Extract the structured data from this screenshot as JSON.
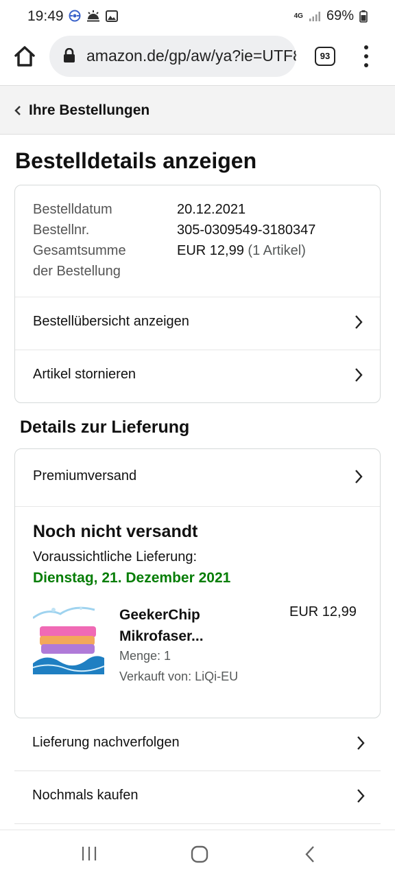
{
  "status_bar": {
    "time": "19:49",
    "network": "4G",
    "battery": "69%"
  },
  "browser": {
    "url": "amazon.de/gp/aw/ya?ie=UTF8",
    "tab_count": "93"
  },
  "back_link": {
    "label": "Ihre Bestellungen"
  },
  "page_title": "Bestelldetails anzeigen",
  "order_summary": {
    "date_label": "Bestelldatum",
    "date_value": "20.12.2021",
    "number_label": "Bestellnr.",
    "number_value": "305-0309549-3180347",
    "total_label_line1": "Gesamtsumme",
    "total_label_line2": "der Bestellung",
    "total_value": "EUR 12,99",
    "total_count": "(1 Artikel)",
    "rows": [
      {
        "label": "Bestellübersicht anzeigen"
      },
      {
        "label": "Artikel stornieren"
      }
    ]
  },
  "delivery": {
    "section_title": "Details zur Lieferung",
    "shipping_method": "Premiumversand",
    "status": "Noch nicht versandt",
    "expected_label": "Voraussichtliche Lieferung:",
    "expected_date": "Dienstag, 21. Dezember 2021",
    "item": {
      "title_line1": "GeekerChip",
      "title_line2": "Mikrofaser...",
      "price": "EUR 12,99",
      "quantity": "Menge: 1",
      "seller": "Verkauft von: LiQi-EU"
    }
  },
  "actions": [
    {
      "label": "Lieferung nachverfolgen"
    },
    {
      "label": "Nochmals kaufen"
    }
  ],
  "colors": {
    "delivery_date": "#067d06",
    "header_bg": "#f3f3f3",
    "urlbar_bg": "#eeeff1"
  }
}
